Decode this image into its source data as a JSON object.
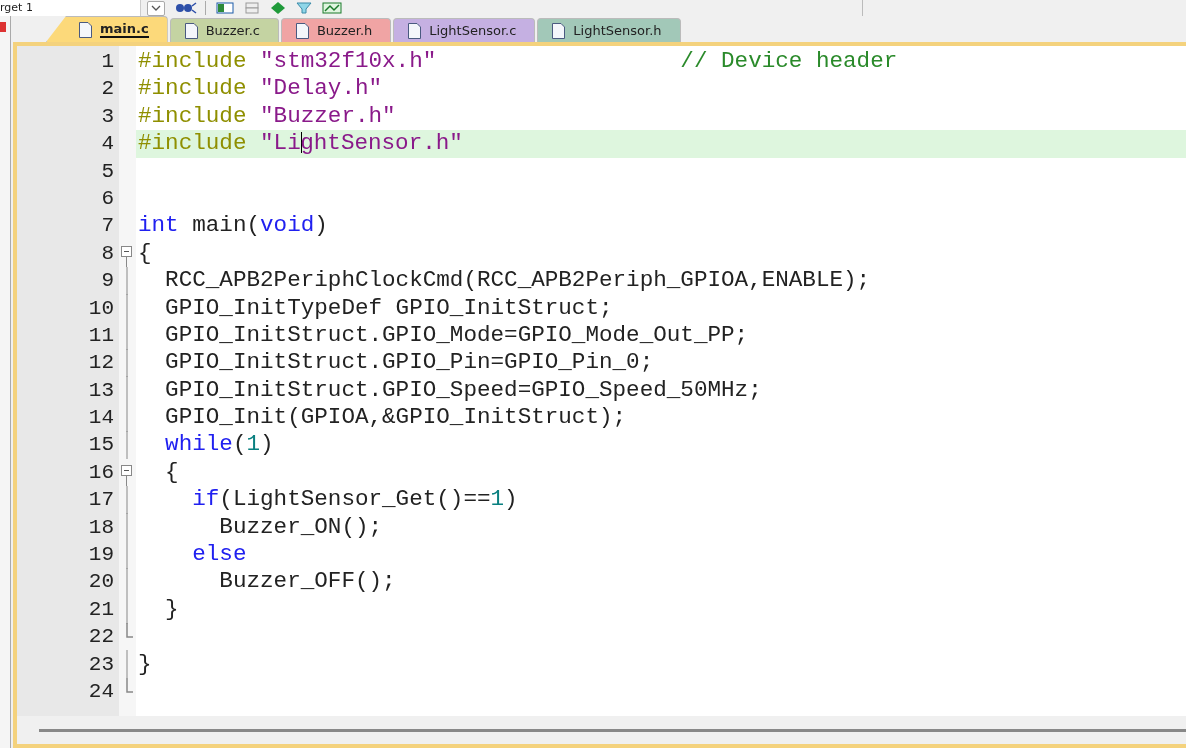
{
  "toolbar": {
    "target_field": "rget 1"
  },
  "tabs": [
    {
      "label": "main.c",
      "selected": true,
      "color": "#fcd97a"
    },
    {
      "label": "Buzzer.c",
      "selected": false,
      "color": "#c4d3a2"
    },
    {
      "label": "Buzzer.h",
      "selected": false,
      "color": "#f0a4a4"
    },
    {
      "label": "LightSensor.c",
      "selected": false,
      "color": "#c5b0e2"
    },
    {
      "label": "LightSensor.h",
      "selected": false,
      "color": "#a2c8b8"
    }
  ],
  "editor": {
    "lines": [
      {
        "number": "1",
        "tokens": [
          {
            "kind": "pre",
            "text": "#include"
          },
          {
            "kind": "str",
            "text": " \"stm32f10x.h\""
          },
          {
            "kind": "comment",
            "text": "                  // Device header"
          }
        ]
      },
      {
        "number": "2",
        "tokens": [
          {
            "kind": "pre",
            "text": "#include"
          },
          {
            "kind": "str",
            "text": " \"Delay.h\""
          }
        ]
      },
      {
        "number": "3",
        "tokens": [
          {
            "kind": "pre",
            "text": "#include"
          },
          {
            "kind": "str",
            "text": " \"Buzzer.h\""
          }
        ]
      },
      {
        "number": "4",
        "current": true,
        "tokens": [
          {
            "kind": "pre",
            "text": "#include"
          },
          {
            "kind": "str",
            "text": " \"Li"
          },
          {
            "kind": "caret"
          },
          {
            "kind": "str",
            "text": "ghtSensor.h\""
          }
        ]
      },
      {
        "number": "5"
      },
      {
        "number": "6"
      },
      {
        "number": "7",
        "tokens": [
          {
            "kind": "kw",
            "text": "int"
          },
          {
            "kind": "plain",
            "text": " main("
          },
          {
            "kind": "kw",
            "text": "void"
          },
          {
            "kind": "plain",
            "text": ")"
          }
        ]
      },
      {
        "number": "8",
        "kind": "fold_start",
        "tokens": [
          {
            "kind": "plain",
            "text": "{"
          }
        ]
      },
      {
        "number": "9",
        "kind": "fold_body",
        "tokens": [
          {
            "kind": "plain",
            "text": "  RCC_APB2PeriphClockCmd(RCC_APB2Periph_GPIOA,ENABLE);"
          }
        ]
      },
      {
        "number": "10",
        "kind": "fold_body",
        "tokens": [
          {
            "kind": "plain",
            "text": "  GPIO_InitTypeDef GPIO_InitStruct;"
          }
        ]
      },
      {
        "number": "11",
        "kind": "fold_body",
        "tokens": [
          {
            "kind": "plain",
            "text": "  GPIO_InitStruct.GPIO_Mode=GPIO_Mode_Out_PP;"
          }
        ]
      },
      {
        "number": "12",
        "kind": "fold_body",
        "tokens": [
          {
            "kind": "plain",
            "text": "  GPIO_InitStruct.GPIO_Pin=GPIO_Pin_0;"
          }
        ]
      },
      {
        "number": "13",
        "kind": "fold_body",
        "tokens": [
          {
            "kind": "plain",
            "text": "  GPIO_InitStruct.GPIO_Speed=GPIO_Speed_50MHz;"
          }
        ]
      },
      {
        "number": "14",
        "kind": "fold_body",
        "tokens": [
          {
            "kind": "plain",
            "text": "  GPIO_Init(GPIOA,&GPIO_InitStruct);"
          }
        ]
      },
      {
        "number": "15",
        "kind": "fold_body",
        "tokens": [
          {
            "kind": "kw",
            "text": "  while"
          },
          {
            "kind": "plain",
            "text": "("
          },
          {
            "kind": "num",
            "text": "1"
          },
          {
            "kind": "plain",
            "text": ")"
          }
        ]
      },
      {
        "number": "16",
        "kind": "fold_start",
        "tokens": [
          {
            "kind": "plain",
            "text": "  {"
          }
        ]
      },
      {
        "number": "17",
        "kind": "fold_body",
        "tokens": [
          {
            "kind": "kw",
            "text": "    if"
          },
          {
            "kind": "plain",
            "text": "(LightSensor_Get()=="
          },
          {
            "kind": "num",
            "text": "1"
          },
          {
            "kind": "plain",
            "text": ")"
          }
        ]
      },
      {
        "number": "18",
        "kind": "fold_body",
        "tokens": [
          {
            "kind": "plain",
            "text": "      Buzzer_ON();"
          }
        ]
      },
      {
        "number": "19",
        "kind": "fold_body",
        "tokens": [
          {
            "kind": "kw",
            "text": "    else"
          }
        ]
      },
      {
        "number": "20",
        "kind": "fold_body",
        "tokens": [
          {
            "kind": "plain",
            "text": "      Buzzer_OFF();"
          }
        ]
      },
      {
        "number": "21",
        "kind": "fold_body",
        "tokens": [
          {
            "kind": "plain",
            "text": "  }"
          }
        ]
      },
      {
        "number": "22",
        "kind": "fold_end"
      },
      {
        "number": "23",
        "kind": "fold_body",
        "tokens": [
          {
            "kind": "plain",
            "text": "}"
          }
        ]
      },
      {
        "number": "24",
        "kind": "fold_end"
      }
    ]
  }
}
